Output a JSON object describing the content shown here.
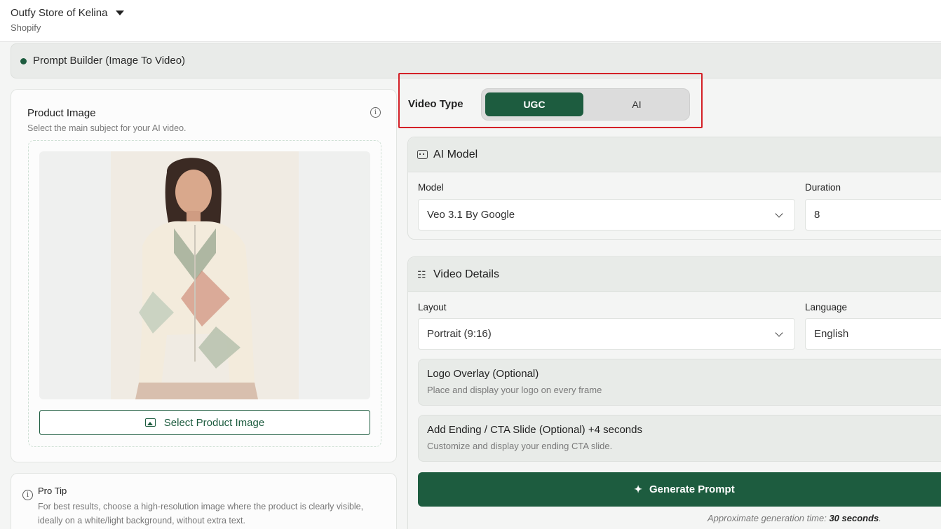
{
  "header": {
    "store_name": "Outfy Store of Kelina",
    "platform": "Shopify"
  },
  "builder": {
    "title": "Prompt Builder (Image To Video)"
  },
  "product_image": {
    "title": "Product Image",
    "subtitle": "Select the main subject for your AI video.",
    "select_button": "Select Product Image"
  },
  "pro_tip": {
    "title": "Pro Tip",
    "text": "For best results, choose a high-resolution image where the product is clearly visible, ideally on a white/light background, without extra text."
  },
  "video_type": {
    "label": "Video Type",
    "options": [
      "UGC",
      "AI"
    ],
    "selected": "UGC",
    "highlight_color": "#d42027"
  },
  "ai_model": {
    "title": "AI Model",
    "model_label": "Model",
    "model_value": "Veo 3.1 By Google",
    "duration_label": "Duration",
    "duration_value": "8"
  },
  "video_details": {
    "title": "Video Details",
    "layout_label": "Layout",
    "layout_value": "Portrait (9:16)",
    "language_label": "Language",
    "language_value": "English",
    "logo_overlay_title": "Logo Overlay (Optional)",
    "logo_overlay_sub": "Place and display your logo on every frame",
    "cta_title": "Add Ending / CTA Slide (Optional) +4 seconds",
    "cta_sub": "Customize and display your ending CTA slide.",
    "generate_button": "Generate Prompt",
    "gen_time_prefix": "Approximate generation time:",
    "gen_time_value": "30 seconds"
  },
  "colors": {
    "accent": "#1d5c3f",
    "highlight": "#d42027"
  }
}
